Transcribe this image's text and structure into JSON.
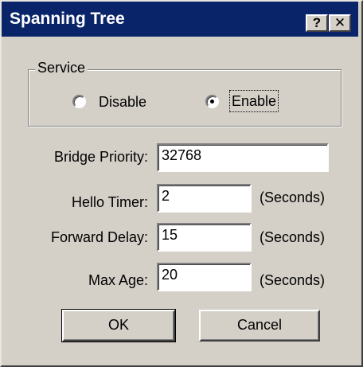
{
  "window": {
    "title": "Spanning Tree",
    "help_glyph": "?",
    "close_glyph": "✕"
  },
  "service": {
    "group_label": "Service",
    "options": [
      {
        "label": "Disable",
        "selected": false
      },
      {
        "label": "Enable",
        "selected": true
      }
    ]
  },
  "fields": {
    "bridge_priority": {
      "label": "Bridge Priority:",
      "value": "32768"
    },
    "hello_timer": {
      "label": "Hello Timer:",
      "value": "2",
      "unit": "(Seconds)"
    },
    "forward_delay": {
      "label": "Forward Delay:",
      "value": "15",
      "unit": "(Seconds)"
    },
    "max_age": {
      "label": "Max Age:",
      "value": "20",
      "unit": "(Seconds)"
    }
  },
  "buttons": {
    "ok": "OK",
    "cancel": "Cancel"
  },
  "colors": {
    "titlebar": "#0a246a",
    "face": "#d4d0c8"
  }
}
